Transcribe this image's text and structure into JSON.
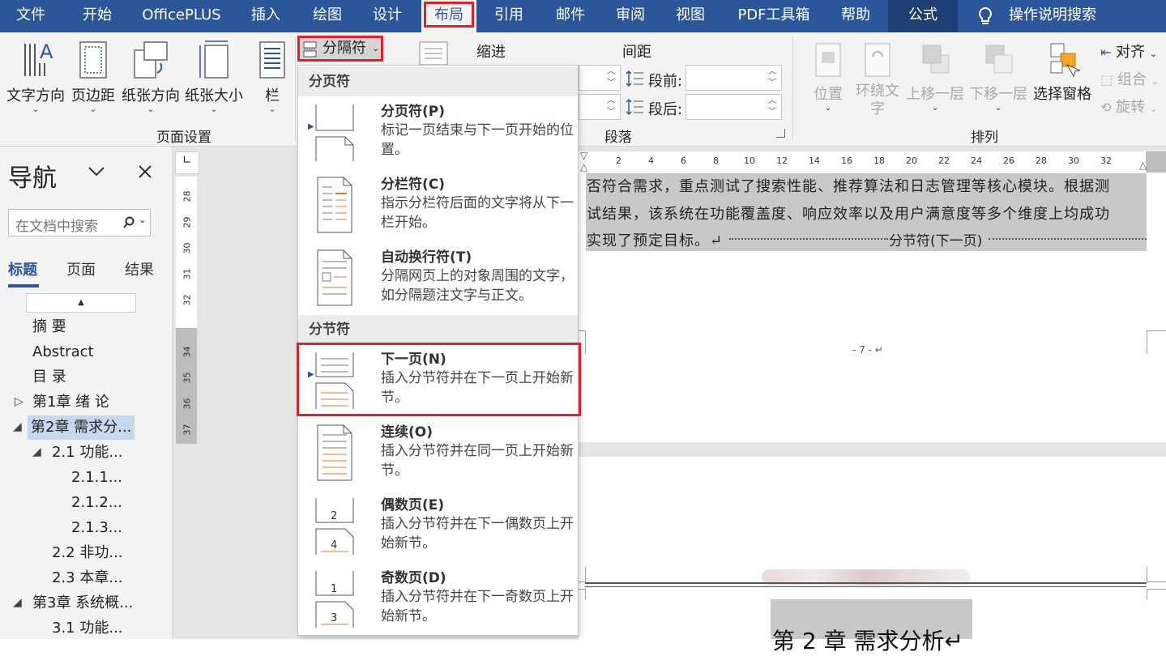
{
  "menubar": {
    "tabs": [
      "文件",
      "开始",
      "OfficePLUS",
      "插入",
      "绘图",
      "设计",
      "布局",
      "引用",
      "邮件",
      "审阅",
      "视图",
      "PDF工具箱",
      "帮助",
      "公式"
    ],
    "active_tab": "布局",
    "tell_me": "操作说明搜索"
  },
  "ribbon": {
    "page_setup": {
      "text_direction": "文字方向",
      "margins": "页边距",
      "orientation": "纸张方向",
      "size": "纸张大小",
      "columns": "栏",
      "breaks": "分隔符",
      "group_label": "页面设置"
    },
    "paragraph": {
      "indent_label": "缩进",
      "spacing_label": "间距",
      "before_label": "段前:",
      "after_label": "段后:",
      "group_label": "段落"
    },
    "arrange": {
      "position": "位置",
      "wrap_text": "环绕文字",
      "bring_forward": "上移一层",
      "send_backward": "下移一层",
      "selection_pane": "选择窗格",
      "align": "对齐",
      "group": "组合",
      "rotate": "旋转",
      "group_label": "排列"
    }
  },
  "nav": {
    "title": "导航",
    "search_placeholder": "在文档中搜索",
    "tabs": [
      "标题",
      "页面",
      "结果"
    ],
    "items": [
      "摘 要",
      "Abstract",
      "目 录",
      "第1章 绪 论",
      "第2章 需求分...",
      "2.1 功能...",
      "2.1.1...",
      "2.1.2...",
      "2.1.3...",
      "2.2 非功...",
      "2.3 本章...",
      "第3章 系统概...",
      "3.1 功能..."
    ]
  },
  "vruler": [
    "28",
    "29",
    "30",
    "31",
    "32",
    "34",
    "35",
    "36",
    "37"
  ],
  "hruler": [
    "2",
    "4",
    "6",
    "8",
    "10",
    "12",
    "14",
    "16",
    "18",
    "20",
    "22",
    "24",
    "26",
    "28",
    "30",
    "32"
  ],
  "document": {
    "line1": "否符合需求，重点测试了搜索性能、推荐算法和日志管理等核心模块。根据测",
    "line2": "试结果，该系统在功能覆盖度、响应效率以及用户满意度等多个维度上均成功",
    "line3": "实现了预定目标。↵",
    "section_break": "分节符(下一页)",
    "page_number": "- 7 - ↵",
    "heading": "第 2 章   需求分析↵"
  },
  "dropdown": {
    "page_breaks_header": "分页符",
    "section_breaks_header": "分节符",
    "items": [
      {
        "title": "分页符(P)",
        "desc": "标记一页结束与下一页开始的位置。"
      },
      {
        "title": "分栏符(C)",
        "desc": "指示分栏符后面的文字将从下一栏开始。"
      },
      {
        "title": "自动换行符(T)",
        "desc": "分隔网页上的对象周围的文字，如分隔题注文字与正文。"
      },
      {
        "title": "下一页(N)",
        "desc": "插入分节符并在下一页上开始新节。"
      },
      {
        "title": "连续(O)",
        "desc": "插入分节符并在同一页上开始新节。"
      },
      {
        "title": "偶数页(E)",
        "desc": "插入分节符并在下一偶数页上开始新节。"
      },
      {
        "title": "奇数页(D)",
        "desc": "插入分节符并在下一奇数页上开始新节。"
      }
    ],
    "even_icon_numbers": [
      "2",
      "4"
    ],
    "odd_icon_numbers": [
      "1",
      "3"
    ]
  },
  "colors": {
    "accent": "#2b579a",
    "highlight_border": "#e0202a",
    "orange_line": "#e07a2a"
  }
}
